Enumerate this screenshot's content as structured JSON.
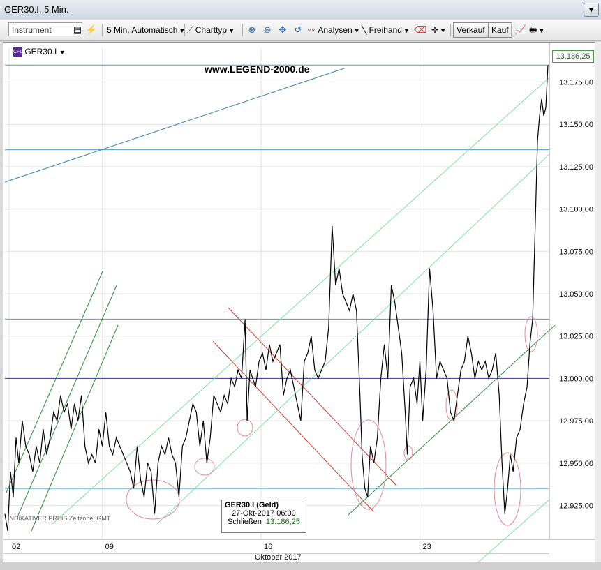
{
  "window": {
    "title": "GER30.I, 5 Min."
  },
  "toolbar": {
    "instrument_placeholder": "Instrument",
    "interval_label": "5 Min,  Automatisch",
    "charttype_label": "Charttyp",
    "analysen_label": "Analysen",
    "freihand_label": "Freihand",
    "verkauf_label": "Verkauf",
    "kauf_label": "Kauf"
  },
  "chart": {
    "symbol": "GER30.I",
    "watermark": "www.LEGEND-2000.de",
    "current_price": "13.186,25",
    "bottom_note": "INDIKATIVER PREIS   Zeitzone: GMT",
    "month_label": "Oktober 2017",
    "tooltip": {
      "title": "GER30.I (Geld)",
      "datetime": "27-Okt-2017 06:00",
      "close_label": "Schließen",
      "close_value": "13.186,25"
    },
    "colors": {
      "cyan_line": "#3ea7c9",
      "navy_line": "#3b3b8f",
      "red_channel": "#d23a2a",
      "green_channel": "#2e8b3a",
      "light_green": "#7fe0a8",
      "price": "#000000"
    }
  },
  "chart_data": {
    "type": "line",
    "title": "",
    "xlabel": "Oktober 2017",
    "ylabel": "",
    "ylim": [
      12905,
      13195
    ],
    "x_ticks": [
      "02",
      "09",
      "16",
      "23"
    ],
    "y_ticks": [
      "12.925,00",
      "12.950,00",
      "12.975,00",
      "13.000,00",
      "13.025,00",
      "13.050,00",
      "13.075,00",
      "13.100,00",
      "13.125,00",
      "13.150,00",
      "13.175,00"
    ],
    "horizontal_lines": [
      13185,
      13135,
      13035,
      13000,
      12935
    ],
    "series": [
      {
        "values": [
          [
            0,
            12920
          ],
          [
            4,
            12910
          ],
          [
            8,
            12945
          ],
          [
            12,
            12930
          ],
          [
            16,
            12965
          ],
          [
            20,
            12950
          ],
          [
            25,
            12975
          ],
          [
            30,
            12960
          ],
          [
            35,
            12955
          ],
          [
            40,
            12945
          ],
          [
            45,
            12960
          ],
          [
            50,
            12950
          ],
          [
            55,
            12970
          ],
          [
            60,
            12955
          ],
          [
            65,
            12965
          ],
          [
            70,
            12980
          ],
          [
            75,
            12975
          ],
          [
            80,
            12990
          ],
          [
            85,
            12980
          ],
          [
            90,
            12985
          ],
          [
            95,
            12970
          ],
          [
            100,
            12985
          ],
          [
            105,
            12975
          ],
          [
            110,
            12990
          ],
          [
            115,
            12960
          ],
          [
            120,
            12950
          ],
          [
            125,
            12955
          ],
          [
            130,
            12950
          ],
          [
            135,
            12970
          ],
          [
            140,
            12960
          ],
          [
            145,
            12980
          ],
          [
            150,
            12960
          ],
          [
            155,
            12955
          ],
          [
            160,
            12965
          ],
          [
            165,
            12960
          ],
          [
            170,
            12955
          ],
          [
            175,
            12950
          ],
          [
            180,
            12945
          ],
          [
            185,
            12935
          ],
          [
            190,
            12960
          ],
          [
            195,
            12940
          ],
          [
            200,
            12930
          ],
          [
            205,
            12950
          ],
          [
            210,
            12945
          ],
          [
            215,
            12920
          ],
          [
            220,
            12950
          ],
          [
            225,
            12960
          ],
          [
            230,
            12955
          ],
          [
            235,
            12965
          ],
          [
            240,
            12955
          ],
          [
            245,
            12950
          ],
          [
            250,
            12930
          ],
          [
            255,
            12960
          ],
          [
            260,
            12965
          ],
          [
            265,
            12975
          ],
          [
            270,
            12985
          ],
          [
            275,
            12980
          ],
          [
            280,
            12960
          ],
          [
            285,
            12975
          ],
          [
            290,
            12950
          ],
          [
            295,
            12965
          ],
          [
            300,
            12990
          ],
          [
            305,
            12985
          ],
          [
            310,
            12980
          ],
          [
            315,
            12990
          ],
          [
            320,
            12985
          ],
          [
            325,
            13000
          ],
          [
            330,
            12995
          ],
          [
            335,
            13005
          ],
          [
            340,
            13000
          ],
          [
            345,
            13035
          ],
          [
            348,
            12975
          ],
          [
            352,
            13005
          ],
          [
            356,
            13000
          ],
          [
            360,
            12995
          ],
          [
            365,
            13010
          ],
          [
            370,
            13015
          ],
          [
            375,
            13005
          ],
          [
            380,
            13020
          ],
          [
            385,
            13010
          ],
          [
            390,
            13015
          ],
          [
            395,
            13020
          ],
          [
            400,
            12990
          ],
          [
            405,
            13000
          ],
          [
            410,
            13005
          ],
          [
            415,
            12995
          ],
          [
            420,
            12985
          ],
          [
            425,
            12975
          ],
          [
            430,
            13010
          ],
          [
            435,
            13015
          ],
          [
            440,
            13025
          ],
          [
            445,
            13005
          ],
          [
            450,
            13000
          ],
          [
            455,
            13005
          ],
          [
            460,
            13010
          ],
          [
            465,
            13030
          ],
          [
            470,
            13090
          ],
          [
            475,
            13055
          ],
          [
            480,
            13065
          ],
          [
            485,
            13050
          ],
          [
            490,
            13045
          ],
          [
            495,
            13040
          ],
          [
            500,
            13050
          ],
          [
            505,
            13040
          ],
          [
            510,
            12990
          ],
          [
            513,
            12955
          ],
          [
            517,
            12935
          ],
          [
            521,
            12930
          ],
          [
            525,
            12960
          ],
          [
            530,
            12950
          ],
          [
            535,
            12965
          ],
          [
            540,
            13000
          ],
          [
            545,
            13020
          ],
          [
            550,
            13000
          ],
          [
            555,
            13055
          ],
          [
            560,
            13045
          ],
          [
            565,
            13030
          ],
          [
            570,
            13015
          ],
          [
            575,
            12980
          ],
          [
            578,
            12955
          ],
          [
            582,
            12995
          ],
          [
            587,
            13000
          ],
          [
            592,
            12985
          ],
          [
            596,
            13010
          ],
          [
            600,
            12975
          ],
          [
            605,
            13005
          ],
          [
            610,
            13065
          ],
          [
            615,
            13040
          ],
          [
            620,
            13000
          ],
          [
            625,
            13010
          ],
          [
            630,
            13005
          ],
          [
            635,
            13000
          ],
          [
            640,
            12980
          ],
          [
            645,
            12975
          ],
          [
            650,
            12990
          ],
          [
            655,
            13005
          ],
          [
            660,
            13010
          ],
          [
            665,
            13025
          ],
          [
            670,
            13015
          ],
          [
            675,
            13000
          ],
          [
            680,
            13010
          ],
          [
            685,
            13005
          ],
          [
            690,
            13010
          ],
          [
            695,
            13000
          ],
          [
            700,
            13005
          ],
          [
            705,
            13015
          ],
          [
            710,
            12990
          ],
          [
            714,
            12950
          ],
          [
            718,
            12920
          ],
          [
            722,
            12935
          ],
          [
            726,
            12955
          ],
          [
            730,
            12945
          ],
          [
            735,
            12965
          ],
          [
            740,
            12970
          ],
          [
            745,
            12985
          ],
          [
            750,
            12995
          ],
          [
            754,
            13020
          ],
          [
            758,
            13035
          ],
          [
            762,
            13095
          ],
          [
            765,
            13140
          ],
          [
            768,
            13155
          ],
          [
            771,
            13165
          ],
          [
            774,
            13155
          ],
          [
            777,
            13160
          ],
          [
            780,
            13185
          ]
        ]
      }
    ]
  }
}
